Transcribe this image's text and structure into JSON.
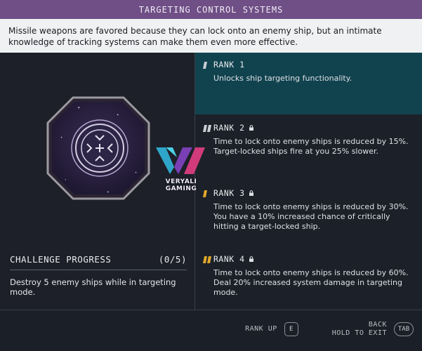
{
  "header": {
    "title": "TARGETING CONTROL SYSTEMS"
  },
  "description": "Missile weapons are favored because they can lock onto an enemy ship, but an intimate knowledge of tracking systems can make them even more effective.",
  "challenge": {
    "title": "CHALLENGE PROGRESS",
    "progress": "(0/5)",
    "description": "Destroy 5 enemy ships while in targeting mode."
  },
  "ranks": [
    {
      "title": "RANK 1",
      "description": "Unlocks ship targeting functionality.",
      "locked": false
    },
    {
      "title": "RANK 2",
      "description": "Time to lock onto enemy ships is reduced by 15%. Target-locked ships fire at you 25% slower.",
      "locked": true
    },
    {
      "title": "RANK 3",
      "description": "Time to lock onto enemy ships is reduced by 30%. You have a 10% increased chance of critically hitting a target-locked ship.",
      "locked": true
    },
    {
      "title": "RANK 4",
      "description": "Time to lock onto enemy ships is reduced by 60%. Deal 20% increased system damage in targeting mode.",
      "locked": true
    }
  ],
  "controls": {
    "rank_up_label": "RANK UP",
    "rank_up_key": "E",
    "back_label": "BACK",
    "hold_to_exit_label": "HOLD TO EXIT",
    "back_key": "TAB"
  },
  "watermark": {
    "text": "VERYALI GAMING"
  },
  "colors": {
    "title_bar": "#6f4f86",
    "active_rank": "#11434f",
    "rank_marker_unlocked": "#c9ced4",
    "rank_marker_locked": "#e3a82b"
  }
}
